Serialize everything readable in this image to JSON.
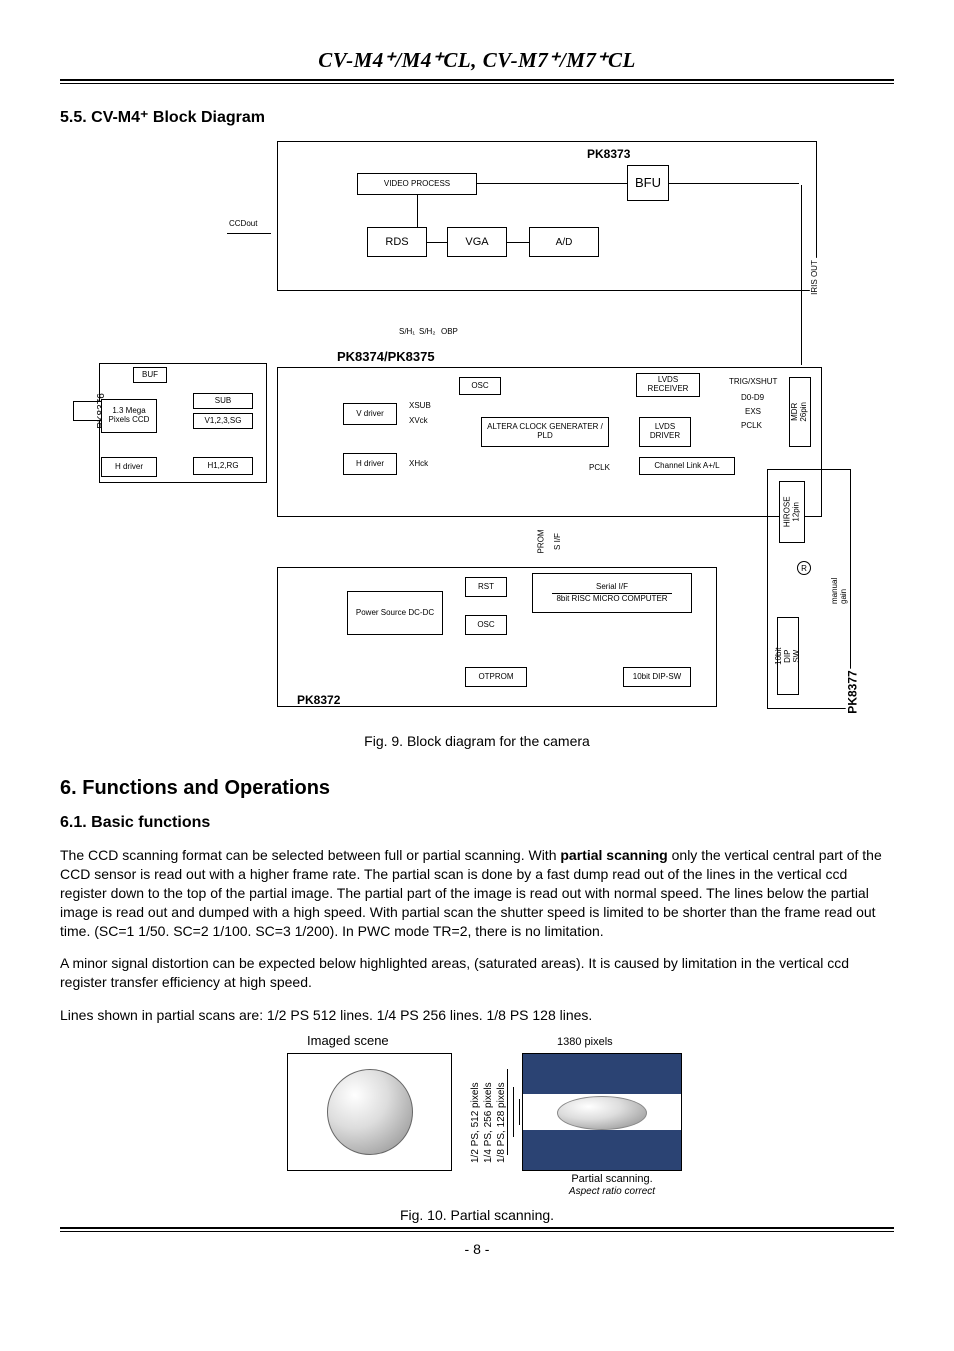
{
  "header": {
    "title_html": "CV-M4⁺/M4⁺CL, CV-M7⁺/M7⁺CL"
  },
  "section55": {
    "title": "5.5. CV-M4⁺ Block Diagram"
  },
  "block_diagram": {
    "pk8373": "PK8373",
    "video_process": "VIDEO PROCESS",
    "bfu": "BFU",
    "rds": "RDS",
    "vga": "VGA",
    "ad": "A/D",
    "ccdout": "CCDout",
    "iris_out": "IRIS OUT",
    "s_hn": "S/H₁",
    "s_h2": "S/H₂",
    "obp": "OBP",
    "pk8374": "PK8374/PK8375",
    "pk8376": "PK8376",
    "buf": "BUF",
    "osc1": "OSC",
    "lvds_rx": "LVDS RECEIVER",
    "trig": "TRIG/XSHUT",
    "d0d9": "D0-D9",
    "exs": "EXS",
    "pclk": "PCLK",
    "mdr26": "MDR 26pin",
    "xsub": "XSUB",
    "xvck": "XVck",
    "xhck": "XHck",
    "sub": "SUB",
    "v1234sg": "V1,2,3,SG",
    "vdriver": "V driver",
    "hdriver": "H driver",
    "h12rg": "H1,2,RG",
    "hdriver2": "H driver",
    "ccd": "1.3 Mega Pixels CCD",
    "altera": "ALTERA CLOCK GENERATER / PLD",
    "lvds_drv": "LVDS DRIVER",
    "channel_link": "Channel Link   A+/L",
    "pclk2": "PCLK",
    "rst": "RST",
    "osc2": "OSC",
    "power": "Power Source DC-DC",
    "otprom": "OTPROM",
    "serial_if": "Serial I/F",
    "micro": "8bit RISC MICRO COMPUTER",
    "dip10": "10bit DIP-SW",
    "dip10b": "10bit DIP SW",
    "manual_gain": "manual gain",
    "r_icon": "R",
    "hirose": "HIROSE 12pin",
    "pk8372": "PK8372",
    "pk8377": "PK8377",
    "prom": "PROM",
    "s_if": "S I/F"
  },
  "fig9_caption": "Fig. 9. Block diagram for the camera",
  "section6": {
    "title": "6. Functions and Operations"
  },
  "section61": {
    "title": "6.1. Basic functions",
    "para1a": "The CCD scanning format can be selected between full or partial scanning. With ",
    "para1b": "partial scanning",
    "para1c": " only the vertical central part of the CCD sensor is read out with a higher frame rate. The partial scan is done by a fast dump read out of the lines in the vertical ccd register down to the top of the partial image. The partial part of the image is read out with normal speed.  The lines below the partial image is read out and dumped with a high speed. With partial scan the shutter speed is limited to be shorter than the frame read out time. (SC=1 1/50. SC=2 1/100. SC=3 1/200). In PWC mode TR=2, there is no limitation.",
    "para2": "A minor signal distortion can be expected below highlighted areas, (saturated areas). It is caused by limitation in the vertical ccd register transfer efficiency at high speed.",
    "para3": "Lines shown in partial scans are: 1/2 PS 512 lines. 1/4 PS 256 lines. 1/8 PS 128 lines."
  },
  "fig10": {
    "imaged_scene": "Imaged scene",
    "pixels_1380": "1380 pixels",
    "ps12": "1/2 PS, 512 pixels",
    "ps14": "1/4 PS, 256 pixels",
    "ps18": "1/8 PS, 128 pixels",
    "partial_scanning": "Partial scanning.",
    "aspect": "Aspect ratio correct"
  },
  "fig10_caption": "Fig. 10. Partial scanning.",
  "page_number": "- 8 -"
}
